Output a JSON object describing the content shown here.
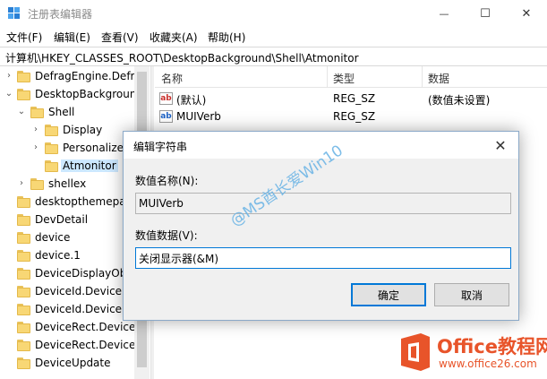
{
  "window": {
    "title": "注册表编辑器",
    "minimize_glyph": "—",
    "maximize_glyph": "☐",
    "close_glyph": "✕"
  },
  "menu": [
    "文件(F)",
    "编辑(E)",
    "查看(V)",
    "收藏夹(A)",
    "帮助(H)"
  ],
  "address": "计算机\\HKEY_CLASSES_ROOT\\DesktopBackground\\Shell\\Atmonitor",
  "tree": [
    {
      "label": "DefragEngine.Defra",
      "chevron": "›",
      "level": 0
    },
    {
      "label": "DesktopBackgroun",
      "chevron": "⌄",
      "level": 0
    },
    {
      "label": "Shell",
      "chevron": "⌄",
      "level": 1
    },
    {
      "label": "Display",
      "chevron": "›",
      "level": 2
    },
    {
      "label": "Personalize",
      "chevron": "›",
      "level": 2
    },
    {
      "label": "Atmonitor",
      "chevron": "",
      "level": 2,
      "selected": true
    },
    {
      "label": "shellex",
      "chevron": "›",
      "level": 1
    },
    {
      "label": "desktopthemepac",
      "chevron": "",
      "level": 0
    },
    {
      "label": "DevDetail",
      "chevron": "",
      "level": 0
    },
    {
      "label": "device",
      "chevron": "",
      "level": 0
    },
    {
      "label": "device.1",
      "chevron": "",
      "level": 0
    },
    {
      "label": "DeviceDisplayObj",
      "chevron": "",
      "level": 0
    },
    {
      "label": "DeviceId.DeviceId",
      "chevron": "",
      "level": 0
    },
    {
      "label": "DeviceId.DeviceId",
      "chevron": "",
      "level": 0
    },
    {
      "label": "DeviceRect.DeviceR",
      "chevron": "",
      "level": 0
    },
    {
      "label": "DeviceRect.DeviceR",
      "chevron": "",
      "level": 0
    },
    {
      "label": "DeviceUpdate",
      "chevron": "",
      "level": 0
    }
  ],
  "list": {
    "headers": {
      "name": "名称",
      "type": "类型",
      "data": "数据"
    },
    "rows": [
      {
        "icon": "ab",
        "name": "(默认)",
        "type": "REG_SZ",
        "data": "(数值未设置)",
        "icon_color": "red"
      },
      {
        "icon": "ab",
        "name": "MUIVerb",
        "type": "REG_SZ",
        "data": "",
        "icon_color": "blue"
      }
    ]
  },
  "dialog": {
    "title": "编辑字符串",
    "close_glyph": "✕",
    "name_label": "数值名称(N):",
    "name_value": "MUIVerb",
    "data_label": "数值数据(V):",
    "data_value": "关闭显示器(&M)",
    "ok_label": "确定",
    "cancel_label": "取消"
  },
  "watermark": "@MS酋长爱Win10",
  "logo": {
    "brand": "Office教程网",
    "url": "www.office26.com",
    "colors": {
      "orange": "#e8542a",
      "red": "#c9302c"
    }
  }
}
